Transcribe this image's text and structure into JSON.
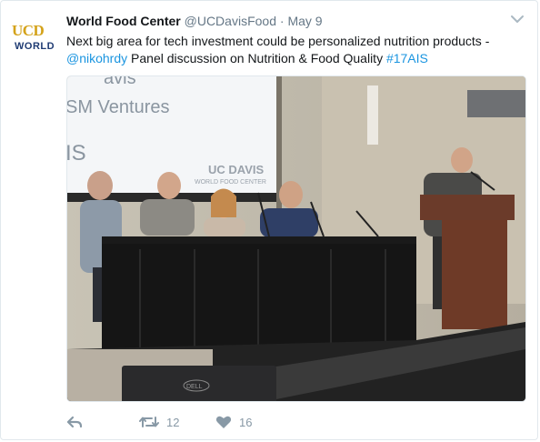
{
  "account": {
    "display_name": "World Food Center",
    "screen_name": "@UCDavisFood",
    "separator": "·",
    "timestamp": "May 9",
    "avatar_text_top": "UCD",
    "avatar_text_bottom": "WORLD"
  },
  "tweet": {
    "text_part1": "Next big area for tech investment could be personalized nutrition products - ",
    "mention": "@nikohrdy",
    "text_part2": " Panel discussion on Nutrition & Food Quality ",
    "hashtag": "#17AIS"
  },
  "photo": {
    "screen_text_line1": "avis",
    "screen_text_line2": "SM Ventures",
    "screen_text_line3": "IS",
    "screen_logo_line1": "UC DAVIS",
    "screen_logo_line2": "WORLD FOOD CENTER",
    "laptop_brand": "DELL"
  },
  "actions": {
    "retweet_count": "12",
    "like_count": "16"
  },
  "colors": {
    "link": "#1b95e0",
    "muted": "#657786",
    "action_icon": "#8899a6"
  }
}
